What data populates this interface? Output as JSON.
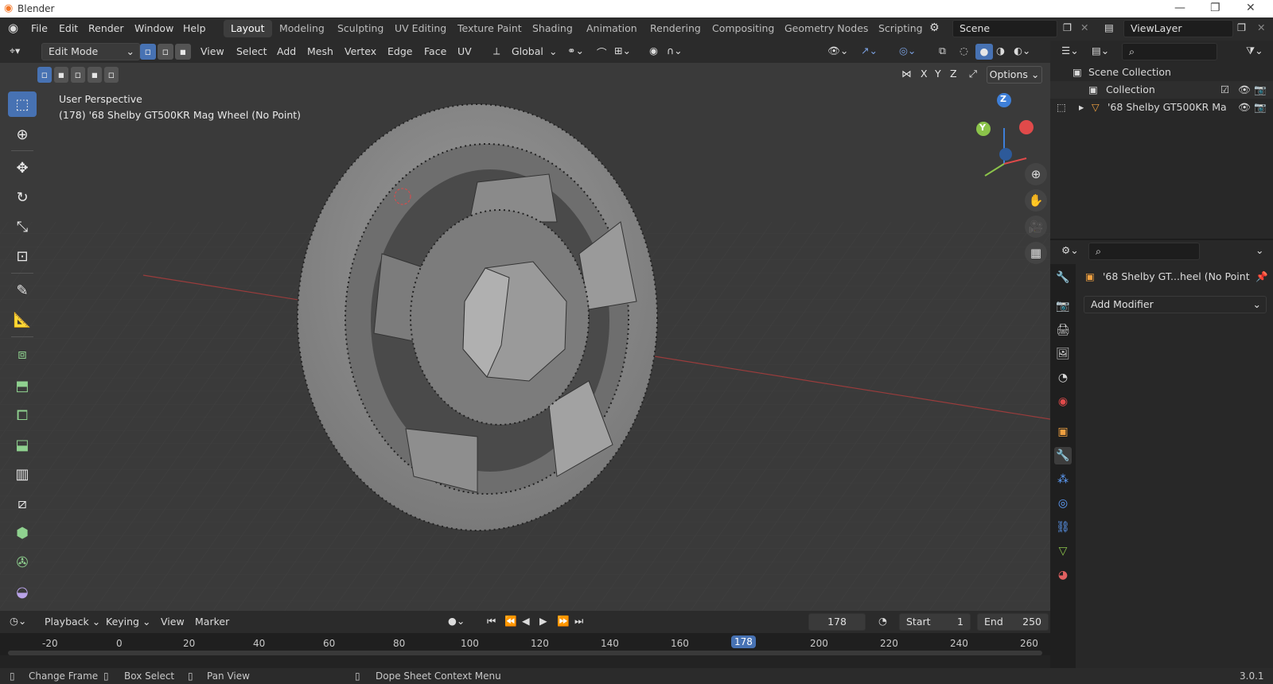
{
  "titlebar": {
    "app": "Blender"
  },
  "menu": [
    "File",
    "Edit",
    "Render",
    "Window",
    "Help"
  ],
  "workspaces": [
    "Layout",
    "Modeling",
    "Sculpting",
    "UV Editing",
    "Texture Paint",
    "Shading",
    "Animation",
    "Rendering",
    "Compositing",
    "Geometry Nodes",
    "Scripting"
  ],
  "scene": "Scene",
  "viewlayer": "ViewLayer",
  "header": {
    "mode": "Edit Mode",
    "menus": [
      "View",
      "Select",
      "Add",
      "Mesh",
      "Vertex",
      "Edge",
      "Face",
      "UV"
    ],
    "orientation": "Global",
    "options": "Options",
    "axes": [
      "X",
      "Y",
      "Z"
    ]
  },
  "viewport": {
    "perspective": "User Perspective",
    "object_info": "(178) '68 Shelby GT500KR Mag Wheel (No Point)",
    "gizmo": {
      "z": "Z",
      "y": "Y"
    }
  },
  "outliner": {
    "scene_collection": "Scene Collection",
    "collection": "Collection",
    "object": "'68 Shelby GT500KR Ma"
  },
  "properties": {
    "object_name": "'68 Shelby GT...heel (No Point",
    "add_modifier": "Add Modifier"
  },
  "timeline": {
    "menus": [
      "Playback",
      "Keying",
      "View",
      "Marker"
    ],
    "current_frame": "178",
    "start_label": "Start",
    "start": "1",
    "end_label": "End",
    "end": "250",
    "ruler": [
      "-20",
      "0",
      "20",
      "40",
      "60",
      "80",
      "100",
      "120",
      "140",
      "160",
      "178",
      "200",
      "220",
      "240",
      "260"
    ]
  },
  "status": {
    "hint1": "Change Frame",
    "hint2": "Box Select",
    "hint3": "Pan View",
    "hint4": "Dope Sheet Context Menu",
    "version": "3.0.1"
  },
  "colors": {
    "accent": "#4772b3",
    "x_axis": "#e04a4a",
    "y_axis": "#8bc34a",
    "z_axis": "#3e7fd8"
  }
}
